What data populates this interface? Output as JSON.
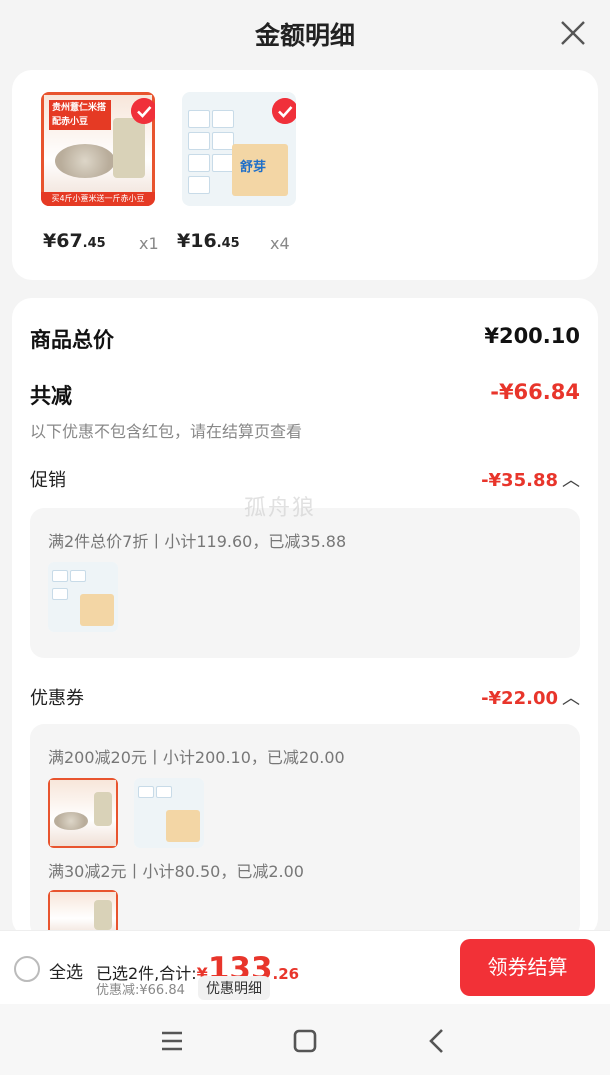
{
  "header": {
    "title": "金额明细"
  },
  "products": [
    {
      "name": "rice-product",
      "price_main": "¥67",
      "price_dec": ".45",
      "qty": "x1",
      "thumb_texts": {
        "tag": "贵州薏仁米搭配赤小豆",
        "band": "买4斤小薏米送一斤赤小豆"
      }
    },
    {
      "name": "tissue-product",
      "price_main": "¥16",
      "price_dec": ".45",
      "qty": "x4",
      "thumb_texts": {
        "logo": "舒芽"
      }
    }
  ],
  "summary": {
    "total_label": "商品总价",
    "total_value": "¥200.10",
    "reduce_label": "共减",
    "reduce_value": "-¥66.84",
    "note": "以下优惠不包含红包，请在结算页查看"
  },
  "promotion": {
    "label": "促销",
    "value": "-¥35.88",
    "rule": "满2件总价7折丨小计119.60，已减35.88"
  },
  "coupon": {
    "label": "优惠券",
    "value": "-¥22.00",
    "rule1": "满200减20元丨小计200.10，已减20.00",
    "rule2": "满30减2元丨小计80.50，已减2.00"
  },
  "watermark": "孤舟狼",
  "bottom": {
    "select_all": "全选",
    "selected_prefix": "已选2件,合计:",
    "currency": "¥",
    "total_big": "133",
    "total_small": ".26",
    "discount": "优惠减:¥66.84",
    "detail_btn": "优惠明细",
    "checkout": "领券结算"
  },
  "colors": {
    "accent": "#e8352b",
    "checkout": "#f23137"
  }
}
